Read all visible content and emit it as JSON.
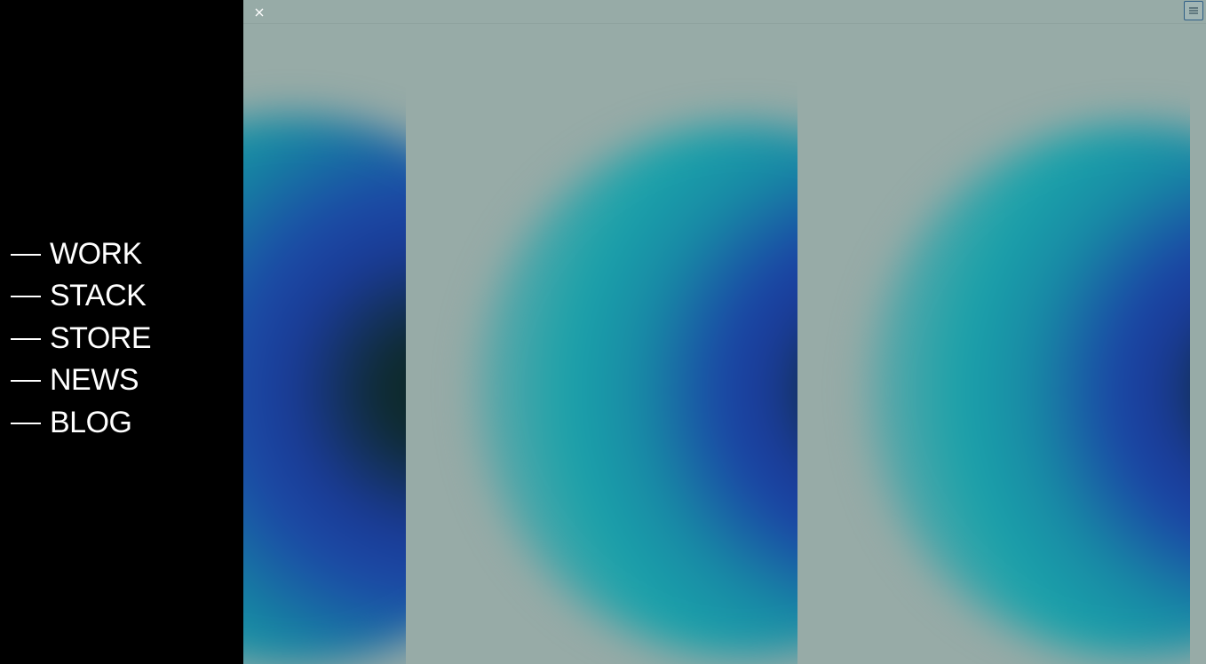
{
  "nav": {
    "items": [
      {
        "label": "WORK"
      },
      {
        "label": "STACK"
      },
      {
        "label": "STORE"
      },
      {
        "label": "NEWS"
      },
      {
        "label": "BLOG"
      }
    ]
  },
  "header": {
    "close_icon": "close-icon",
    "menu_icon": "menu-icon"
  },
  "colors": {
    "sidebar_bg": "#000000",
    "stage_bg": "#97aba7",
    "blob_core": "#0d2a2b",
    "blob_blue": "#1a44a5",
    "blob_cyan": "#1aa2aa"
  }
}
